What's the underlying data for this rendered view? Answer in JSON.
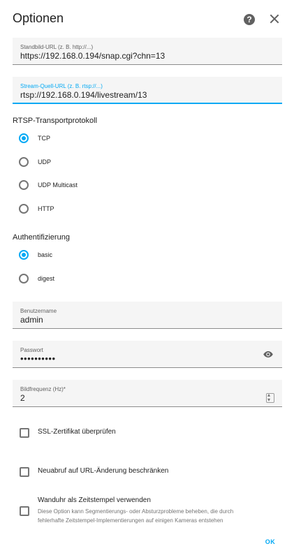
{
  "dialog": {
    "title": "Optionen",
    "ok_label": "OK"
  },
  "icons": {
    "help": "help-circle-icon",
    "close": "close-icon",
    "eye": "eye-icon",
    "radio": "radio-button-icon",
    "checkbox": "checkbox-icon"
  },
  "colors": {
    "accent": "#03a9f4",
    "field_bg": "#f5f5f5",
    "text": "#212121",
    "muted": "#757575"
  },
  "fields": {
    "still_image_url": {
      "label": "Standbild-URL (z. B. http://...)",
      "value": "https://192.168.0.194/snap.cgi?chn=13"
    },
    "stream_source_url": {
      "label": "Stream-Quell-URL (z. B. rtsp://...)",
      "value": "rtsp://192.168.0.194/livestream/13"
    },
    "username": {
      "label": "Benutzername",
      "value": "admin"
    },
    "password": {
      "label": "Passwort",
      "value": "••••••••••"
    },
    "frame_rate": {
      "label": "Bildfrequenz (Hz)*",
      "value": "2"
    }
  },
  "rtsp": {
    "label": "RTSP-Transportprotokoll",
    "options": [
      {
        "label": "TCP",
        "checked": true
      },
      {
        "label": "UDP",
        "checked": false
      },
      {
        "label": "UDP Multicast",
        "checked": false
      },
      {
        "label": "HTTP",
        "checked": false
      }
    ]
  },
  "auth": {
    "label": "Authentifizierung",
    "options": [
      {
        "label": "basic",
        "checked": true
      },
      {
        "label": "digest",
        "checked": false
      }
    ]
  },
  "checkboxes": {
    "verify_ssl": {
      "label": "SSL-Zertifikat überprüfen",
      "checked": false
    },
    "limit_refetch": {
      "label": "Neuabruf auf URL-Änderung beschränken",
      "checked": false
    },
    "wallclock": {
      "label": "Wanduhr als Zeitstempel verwenden",
      "description": "Diese Option kann Segmentierungs- oder Absturzprobleme beheben, die durch fehlerhafte Zeitstempel-Implementierungen auf einigen Kameras entstehen",
      "checked": false
    }
  }
}
